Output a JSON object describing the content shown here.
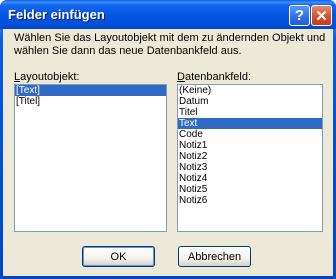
{
  "window": {
    "title": "Felder einfügen",
    "help_glyph": "?",
    "close_glyph": "✕"
  },
  "description": "Wählen Sie das Layoutobjekt mit dem zu ändernden Objekt und wählen Sie dann das neue Datenbankfeld aus.",
  "layout_panel": {
    "label_accel": "L",
    "label_rest": "ayoutobjekt:",
    "items": [
      "[Text]",
      "[Titel]"
    ],
    "selected_index": 0
  },
  "field_panel": {
    "label_accel": "D",
    "label_rest": "atenbankfeld:",
    "items": [
      "(Keine)",
      "Datum",
      "Titel",
      "Text",
      "Code",
      "Notiz1",
      "Notiz2",
      "Notiz3",
      "Notiz4",
      "Notiz5",
      "Notiz6"
    ],
    "selected_index": 3
  },
  "buttons": {
    "ok": "OK",
    "cancel": "Abbrechen"
  },
  "colors": {
    "titlebar": "#0054e3",
    "dialog_bg": "#ece9d8",
    "selection": "#316ac5",
    "close_button": "#d64f2c"
  }
}
